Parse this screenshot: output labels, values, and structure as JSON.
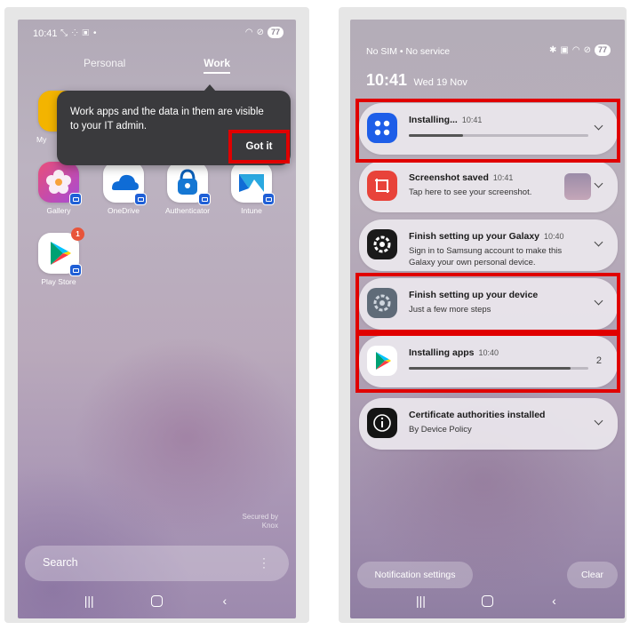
{
  "left_screen": {
    "status_time": "10:41",
    "battery": "77",
    "tabs": [
      "Personal",
      "Work"
    ],
    "apps": [
      {
        "label": "My",
        "color": "#f3b400"
      },
      {
        "label": "Gallery",
        "color": "#e94e7a"
      },
      {
        "label": "OneDrive",
        "color": "#ffffff"
      },
      {
        "label": "Authenticator",
        "color": "#ffffff"
      },
      {
        "label": "Intune",
        "color": "#ffffff"
      },
      {
        "label": "Play Store",
        "color": "#ffffff",
        "badge": "1"
      }
    ],
    "tooltip": {
      "text": "Work apps and the data in them are visible to your IT admin.",
      "button": "Got it"
    },
    "knox": {
      "line1": "Secured by",
      "line2": "Knox"
    },
    "search_placeholder": "Search"
  },
  "right_screen": {
    "status": "No SIM • No service",
    "battery": "77",
    "clock_time": "10:41",
    "clock_date": "Wed 19 Nov",
    "notifications": [
      {
        "title": "Installing...",
        "time": "10:41",
        "sub1": "",
        "sub2": "",
        "progress": 0.3
      },
      {
        "title": "Screenshot saved",
        "time": "10:41",
        "sub1": "Tap here to see your screenshot.",
        "sub2": ""
      },
      {
        "title": "Finish setting up your Galaxy",
        "time": "10:40",
        "sub1": "Sign in to Samsung account to make this",
        "sub2": "Galaxy your own personal device."
      },
      {
        "title": "Finish setting up your device",
        "time": "",
        "sub1": "Just a few more steps",
        "sub2": ""
      },
      {
        "title": "Installing apps",
        "time": "10:40",
        "sub1": "",
        "sub2": "",
        "progress": 0.9,
        "count": "2"
      },
      {
        "title": "Certificate authorities installed",
        "time": "",
        "sub1": "By Device Policy",
        "sub2": ""
      }
    ],
    "notification_settings": "Notification settings",
    "clear": "Clear"
  },
  "colors": {
    "highlight": "#e00000",
    "tooltip_bg": "#3a3a3d",
    "work_badge": "#1f5fd6"
  }
}
